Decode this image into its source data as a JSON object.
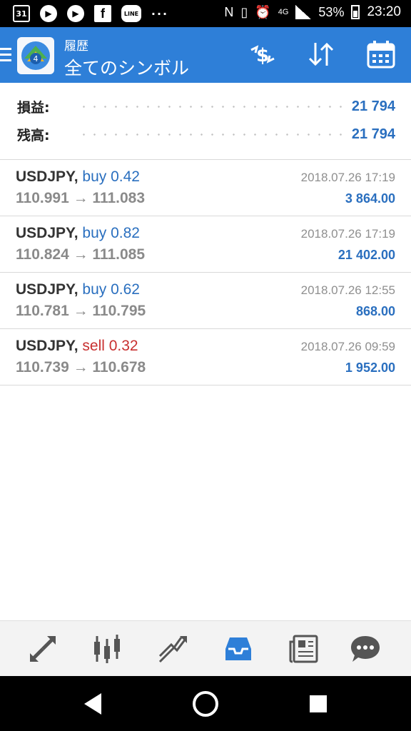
{
  "status_bar": {
    "calendar_day": "31",
    "network": "4G",
    "battery": "53%",
    "time": "23:20",
    "line_label": "LINE",
    "more": "···"
  },
  "app_bar": {
    "title": "履歴",
    "subtitle": "全てのシンボル",
    "accent": "#2e7fd8"
  },
  "summary": {
    "profit_label": "損益:",
    "profit_value": "21 794",
    "balance_label": "残高:",
    "balance_value": "21 794"
  },
  "trades": [
    {
      "symbol": "USDJPY,",
      "side": "buy 0.42",
      "prices": "110.991 → 111.083",
      "time": "2018.07.26 17:19",
      "profit": "3 864.00"
    },
    {
      "symbol": "USDJPY,",
      "side": "buy 0.82",
      "prices": "110.824 → 111.085",
      "time": "2018.07.26 17:19",
      "profit": "21 402.00"
    },
    {
      "symbol": "USDJPY,",
      "side": "buy 0.62",
      "prices": "110.781 → 110.795",
      "time": "2018.07.26 12:55",
      "profit": "868.00"
    },
    {
      "symbol": "USDJPY,",
      "side": "sell 0.32",
      "prices": "110.739 → 110.678",
      "time": "2018.07.26 09:59",
      "profit": "1 952.00"
    }
  ],
  "bottom_nav": [
    "quotes-icon",
    "chart-icon",
    "trade-icon",
    "history-icon",
    "news-icon",
    "chat-icon"
  ],
  "colors": {
    "buy": "#2a6fbf",
    "sell": "#c83030",
    "nav_active": "#2e7fd8",
    "nav_inactive": "#555555"
  }
}
